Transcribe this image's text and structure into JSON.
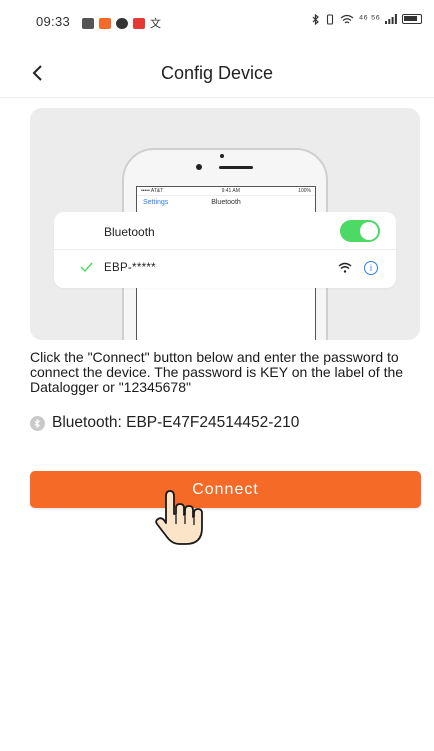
{
  "status_bar": {
    "time": "09:33",
    "left_text": "文",
    "right_text": "⁴⁶ ⁵⁶",
    "icons": [
      "alarm-icon",
      "app-icon",
      "chat-icon",
      "app-badge-icon",
      "bluetooth-icon",
      "vibrate-icon",
      "wifi-icon",
      "signal-icon",
      "battery-icon"
    ]
  },
  "header": {
    "title": "Config Device",
    "back_icon": "chevron-left-icon"
  },
  "illustration": {
    "phone_status": {
      "carrier": "••••• AT&T",
      "time": "9:41 AM",
      "battery": "100%"
    },
    "phone_nav": {
      "back_label": "Settings",
      "title": "Bluetooth"
    },
    "bluetooth_label": "Bluetooth",
    "bluetooth_on": true,
    "device_name": "EBP-*****",
    "colors": {
      "toggle": "#4cd964",
      "check": "#4cd964",
      "info": "#2f7cf6"
    }
  },
  "instruction": "Click the \"Connect\" button below and enter the password to connect the device. The password is KEY on the label of the Datalogger or \"12345678\"",
  "bluetooth_info": "Bluetooth: EBP-E47F24514452-210",
  "connect_label": "Connect",
  "colors": {
    "accent": "#f66a27"
  }
}
